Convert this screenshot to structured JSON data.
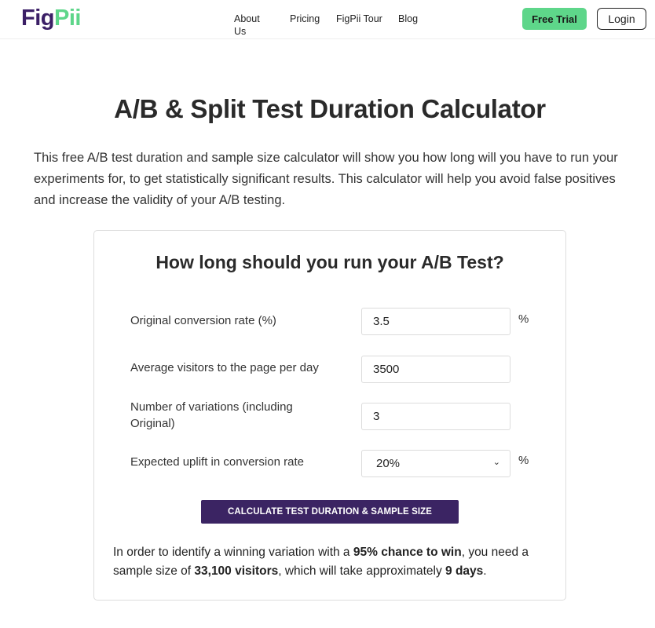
{
  "nav": {
    "logo_part1": "Fig",
    "logo_part2": "Pii",
    "links": [
      "About Us",
      "Pricing",
      "FigPii Tour",
      "Blog"
    ],
    "trial_label": "Free Trial",
    "login_label": "Login"
  },
  "page": {
    "title": "A/B & Split Test Duration Calculator",
    "intro": "This free A/B test duration and sample size calculator will show you how long will you have to run your experiments for, to get statistically significant results. This calculator will help you avoid false positives and increase the validity of your A/B testing."
  },
  "calculator": {
    "title": "How long should you run your A/B Test?",
    "fields": [
      {
        "label": "Original conversion rate (%)",
        "value": "3.5",
        "unit": "%"
      },
      {
        "label": "Average visitors to the page per day",
        "value": "3500",
        "unit": ""
      },
      {
        "label": "Number of variations (including Original)",
        "value": "3",
        "unit": ""
      },
      {
        "label": "Expected uplift in conversion rate",
        "value": "20%",
        "unit": "%"
      }
    ],
    "button_label": "CALCULATE TEST DURATION & SAMPLE SIZE",
    "result": {
      "text1": "In order to identify a winning variation with a ",
      "chance": "95% chance to win",
      "text2": ", you need a sample size of ",
      "sample": "33,100 visitors",
      "text3": ", which will take approximately ",
      "days": "9 days",
      "text4": "."
    }
  },
  "colors": {
    "brand_dark": "#3b1f66",
    "brand_green": "#5ed68a",
    "button_dark": "#3b2463"
  }
}
